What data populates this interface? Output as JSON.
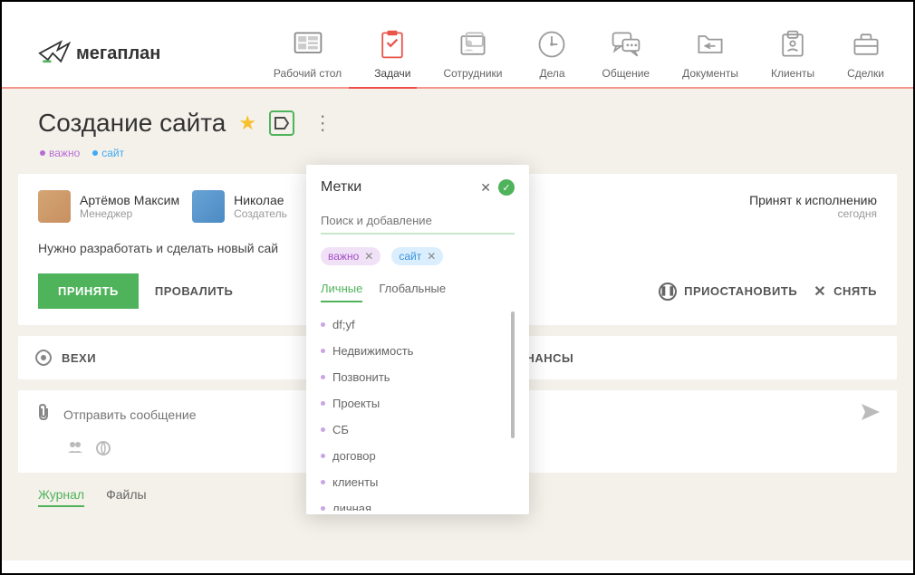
{
  "logo": {
    "text": "мегаплан"
  },
  "nav": {
    "items": [
      {
        "label": "Рабочий стол"
      },
      {
        "label": "Задачи"
      },
      {
        "label": "Сотрудники"
      },
      {
        "label": "Дела"
      },
      {
        "label": "Общение"
      },
      {
        "label": "Документы"
      },
      {
        "label": "Клиенты"
      },
      {
        "label": "Сделки"
      }
    ]
  },
  "page": {
    "title": "Создание сайта",
    "tags": [
      {
        "label": "важно",
        "color": "purple"
      },
      {
        "label": "сайт",
        "color": "blue"
      }
    ]
  },
  "people": [
    {
      "name": "Артёмов Максим",
      "role": "Менеджер"
    },
    {
      "name": "Николае",
      "role": "Создатель"
    }
  ],
  "status": {
    "title": "Принят к исполнению",
    "sub": "сегодня"
  },
  "description": "Нужно разработать и сделать новый сай",
  "actions": {
    "accept": "ПРИНЯТЬ",
    "fail": "ПРОВАЛИТЬ",
    "pause": "ПРИОСТАНОВИТЬ",
    "remove": "СНЯТЬ"
  },
  "cols": {
    "milestones": "ВЕХИ",
    "finances": "ФИНАНСЫ"
  },
  "message": {
    "placeholder": "Отправить сообщение"
  },
  "bottom_tabs": [
    {
      "label": "Журнал",
      "active": true
    },
    {
      "label": "Файлы",
      "active": false
    }
  ],
  "popup": {
    "title": "Метки",
    "search_placeholder": "Поиск и добавление",
    "selected": [
      {
        "label": "важно",
        "color": "purple"
      },
      {
        "label": "сайт",
        "color": "blue"
      }
    ],
    "tabs": [
      {
        "label": "Личные",
        "active": true
      },
      {
        "label": "Глобальные",
        "active": false
      }
    ],
    "items": [
      "df;yf",
      "Недвижимость",
      "Позвонить",
      "Проекты",
      "СБ",
      "договор",
      "клиенты",
      "личная"
    ]
  }
}
